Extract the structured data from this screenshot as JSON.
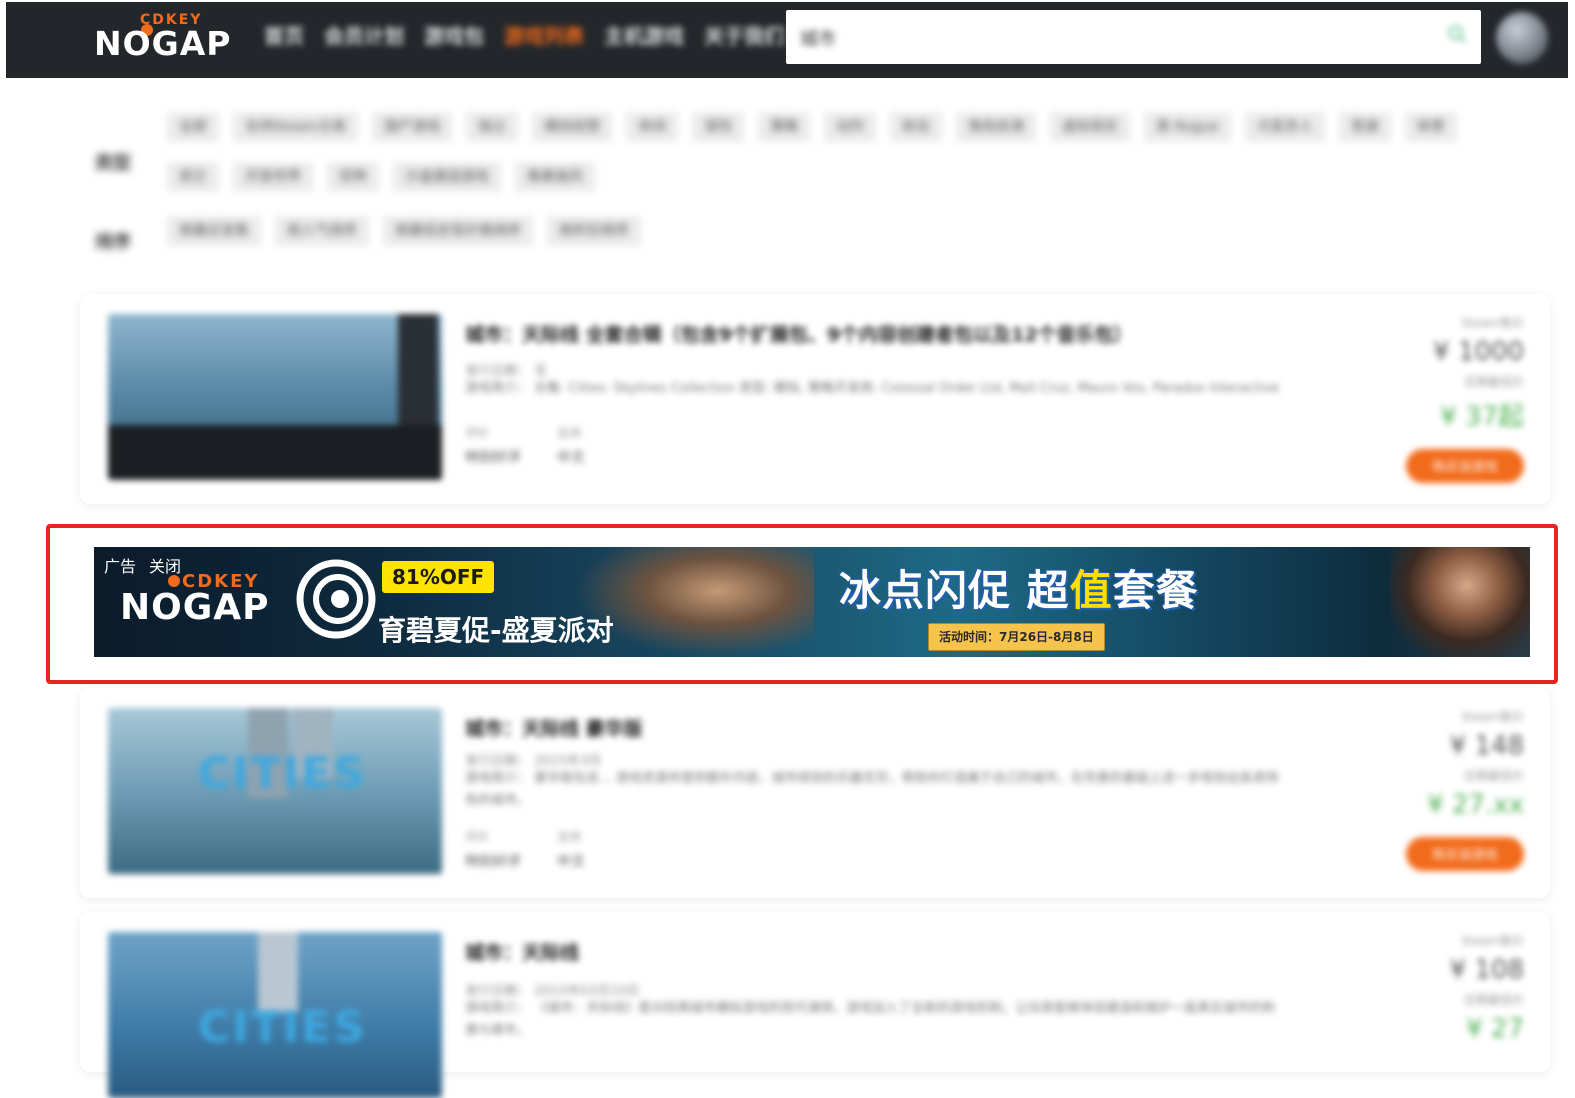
{
  "header": {
    "logo_top": "CDKEY",
    "logo_main": "NOGAP",
    "nav": [
      "首页",
      "会员计划",
      "游戏包",
      "游戏列表",
      "主机游戏",
      "关于我们"
    ],
    "active_nav_index": 3,
    "search_value": "城市"
  },
  "filters": {
    "type_label": "类型",
    "type_chips": [
      "全部",
      "支持Steam交易",
      "国产游戏",
      "独立",
      "模拟经营",
      "休闲",
      "冒险",
      "策略",
      "动作",
      "射击",
      "角色扮演",
      "虚拟现实",
      "类 Rogue",
      "大型多人",
      "竞速",
      "体育",
      "其它",
      "开放世界",
      "恐怖",
      "沙盒建造游戏",
      "像素画风"
    ],
    "sort_label": "排序",
    "sort_chips": [
      "按最近发售",
      "按人气排序",
      "按最低史低价格排序",
      "按折扣排序"
    ]
  },
  "games": [
    {
      "title": "城市：天际线 全套合辑（包含9个扩展包、9个内容创建者包以及12个音乐包）",
      "meta": "发行日期： 无",
      "desc": "游戏简介： 合集: Cities: Skylines Collection 类型: 模拟, 策略开发商: Colossal Order Ltd, Mall Cruz, Mauro Vos, Paradox Interactive",
      "info_k1": "评价",
      "info_v1": "特别好评",
      "info_k2": "支持",
      "info_v2": "中文",
      "price_label": "Steam售价",
      "price": "¥ 1000",
      "low_label": "近期最低价",
      "low_price": "¥ 37起",
      "button": "购买该游戏"
    },
    {
      "title": "城市：天际线 豪华版",
      "meta": "发行日期： 2015年3月",
      "desc": "游戏简介： 豪华版包含... 游戏资源并提供额外内容，城市规划的乐趣无穷，帮助你打造属于自己的城市，在完善的基础上进一步规划出各具特色的城市。",
      "info_k1": "评价",
      "info_v1": "特别好评",
      "info_k2": "支持",
      "info_v2": "中文",
      "price_label": "Steam售价",
      "price": "¥ 148",
      "low_label": "近期最低价",
      "low_price": "¥ 27.xx",
      "button": "购买该游戏"
    },
    {
      "title": "城市：天际线",
      "meta": "发行日期： 2015年03月10日",
      "desc": "游戏简介： 《城市：天际线》是对经典城市模拟游戏的现代演绎，游戏加入了全新的游戏机制，让玩家能够体验建造和维护一座真实城市的刺激与艰辛。",
      "price_label": "Steam售价",
      "price": "¥ 108",
      "low_label": "近期最低价",
      "low_price": "¥ 27"
    }
  ],
  "ad": {
    "label": "广告",
    "close": "关闭",
    "logo_top": "CDKEY",
    "logo_main": "NOGAP",
    "discount": "81%OFF",
    "subtitle": "育碧夏促-盛夏派对",
    "headline_a": "冰点闪促 超",
    "headline_b": "值",
    "headline_c": "套餐",
    "date": "活动时间：7月26日-8月8日"
  }
}
